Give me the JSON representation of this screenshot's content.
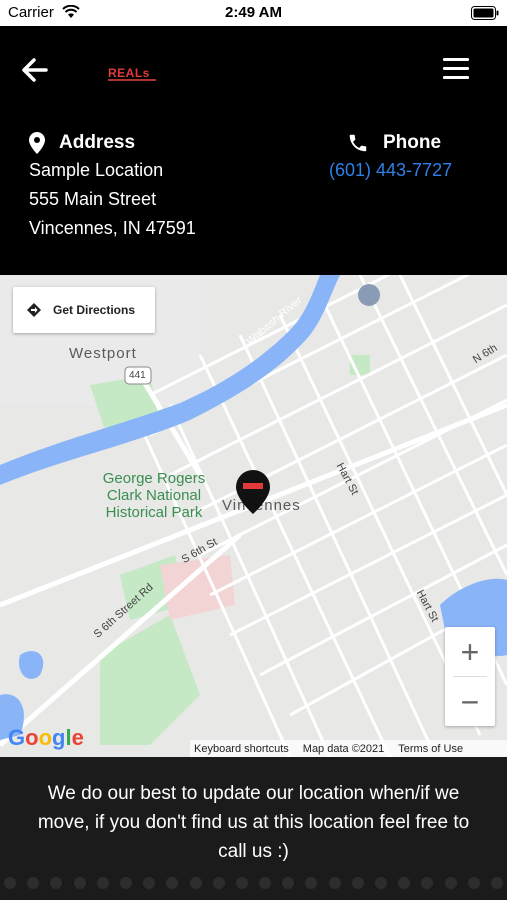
{
  "status_bar": {
    "carrier": "Carrier",
    "time": "2:49 AM"
  },
  "nav": {
    "logo_text": "REALs"
  },
  "address": {
    "heading": "Address",
    "lines": [
      "Sample Location",
      "555 Main Street",
      "Vincennes, IN 47591"
    ]
  },
  "phone": {
    "heading": "Phone",
    "number": "(601) 443-7727"
  },
  "map": {
    "directions_label": "Get Directions",
    "place_labels": {
      "westport": "Westport",
      "vincennes": "Vincennes",
      "park": "George Rogers Clark National Historical Park",
      "route": "441"
    },
    "street_labels": {
      "wabash": "Wabash River",
      "s6th_st": "S 6th St",
      "s6th_street_rd": "S 6th Street Rd",
      "hart_st_1": "Hart St",
      "hart_st_2": "Hart St",
      "n6th": "N 6th"
    },
    "zoom_in": "+",
    "zoom_out": "−",
    "footer": {
      "shortcuts": "Keyboard shortcuts",
      "data": "Map data ©2021",
      "terms": "Terms of Use"
    },
    "google": [
      "G",
      "o",
      "o",
      "g",
      "l",
      "e"
    ]
  },
  "bottom": {
    "message": "We do our best to update our location when/if we move, if you don't find us at this location feel free to call us :)"
  },
  "colors": {
    "link": "#2f7fe8",
    "river": "#8ab4f8",
    "park": "#c5e8c5"
  }
}
